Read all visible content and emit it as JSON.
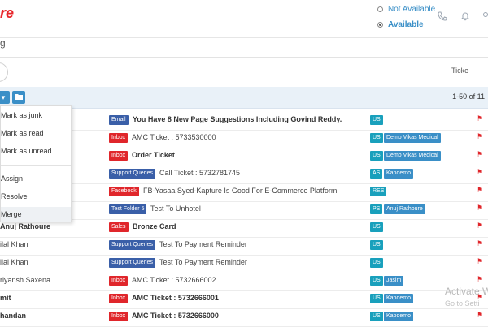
{
  "header": {
    "logo_text": "re",
    "status_options": [
      {
        "label": "Not Available",
        "checked": false
      },
      {
        "label": "Available",
        "checked": true
      }
    ],
    "icons": [
      "phone-icon",
      "bell-icon",
      "user-icon"
    ]
  },
  "subheader": {
    "glyph": "g"
  },
  "toolbar": {
    "ticket_tab_label": "Ticke"
  },
  "action_bar": {
    "pagination": "1-50 of 11"
  },
  "dropdown": {
    "items": [
      "Mark as junk",
      "Mark as read",
      "Mark as unread",
      "Assign",
      "Resolve",
      "Merge"
    ]
  },
  "rows": [
    {
      "name": "...c...",
      "tag": "Email",
      "tag_color": "#3a5fa8",
      "subject": "You Have 8 New Page Suggestions Including Govind Reddy.",
      "subject_bold": true,
      "code": "US",
      "agent": ""
    },
    {
      "name": "",
      "tag": "Inbox",
      "tag_color": "#e0262b",
      "subject": "AMC Ticket : 5733530000",
      "subject_bold": false,
      "code": "US",
      "agent": "Demo Vikas Medical"
    },
    {
      "name": "",
      "tag": "Inbox",
      "tag_color": "#e0262b",
      "subject": "Order Ticket",
      "subject_bold": true,
      "code": "US",
      "agent": "Demo Vikas Medical"
    },
    {
      "name": "",
      "tag": "Support Queries",
      "tag_color": "#3a5fa8",
      "subject": "Call Ticket : 5732781745",
      "subject_bold": false,
      "code": "AS",
      "agent": "Kapdemo"
    },
    {
      "name": "",
      "tag": "Facebook",
      "tag_color": "#e0262b",
      "subject": "FB-Yasaa Syed-Kapture Is Good For E-Commerce Platform",
      "subject_bold": false,
      "code": "RES",
      "agent": ""
    },
    {
      "name": "",
      "tag": "Test Folder 5",
      "tag_color": "#3a5fa8",
      "subject": "Test To Unhotel",
      "subject_bold": false,
      "code": "PS",
      "agent": "Anuj Rathoure"
    },
    {
      "name": "Anuj Rathoure",
      "name_bold": true,
      "tag": "Sales",
      "tag_color": "#e0262b",
      "subject": "Bronze Card",
      "subject_bold": true,
      "code": "US",
      "agent": ""
    },
    {
      "name": "ilal Khan",
      "tag": "Support Queries",
      "tag_color": "#3a5fa8",
      "subject": "Test To Payment Reminder",
      "subject_bold": false,
      "code": "US",
      "agent": ""
    },
    {
      "name": "ilal Khan",
      "tag": "Support Queries",
      "tag_color": "#3a5fa8",
      "subject": "Test To Payment Reminder",
      "subject_bold": false,
      "code": "US",
      "agent": ""
    },
    {
      "name": "riyansh Saxena",
      "tag": "Inbox",
      "tag_color": "#e0262b",
      "subject": "AMC Ticket : 5732666002",
      "subject_bold": false,
      "code": "US",
      "agent": "Jasim"
    },
    {
      "name": "mit",
      "name_bold": true,
      "tag": "Inbox",
      "tag_color": "#e0262b",
      "subject": "AMC Ticket : 5732666001",
      "subject_bold": true,
      "code": "US",
      "agent": "Kapdemo"
    },
    {
      "name": "handan",
      "name_bold": true,
      "tag": "Inbox",
      "tag_color": "#e0262b",
      "subject": "AMC Ticket : 5732666000",
      "subject_bold": true,
      "code": "US",
      "agent": "Kapdemo"
    }
  ],
  "watermark": {
    "line1": "Activate W",
    "line2": "Go to Setti"
  },
  "colors": {
    "accent": "#3a8fc7",
    "brand": "#e8262b",
    "code_badge": "#19a0bc"
  }
}
